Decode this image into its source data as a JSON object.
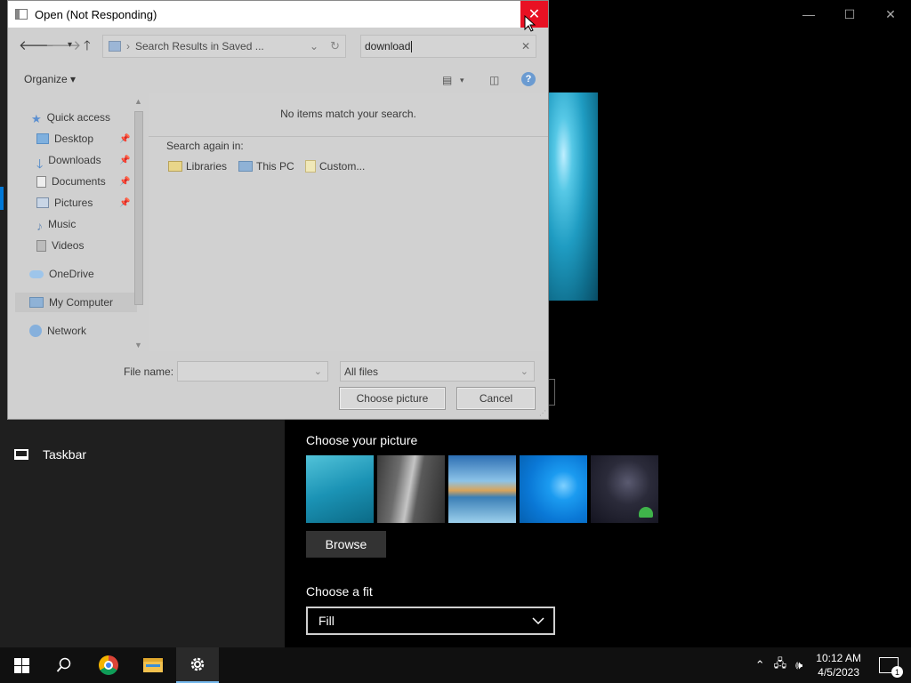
{
  "settings": {
    "nav_taskbar": "Taskbar",
    "choose_picture_label": "Choose your picture",
    "browse_label": "Browse",
    "choose_fit_label": "Choose a fit",
    "fit_value": "Fill",
    "window_controls": {
      "minimize": "—",
      "maximize": "☐",
      "close": "✕"
    }
  },
  "dialog": {
    "title": "Open (Not Responding)",
    "close_glyph": "✕",
    "address": "Search Results in Saved ...",
    "search_value": "download",
    "organize_label": "Organize ▾",
    "nav_items": [
      {
        "label": "Quick access",
        "icon": "star-icon"
      },
      {
        "label": "Desktop",
        "icon": "desktop-icon",
        "pinned": true
      },
      {
        "label": "Downloads",
        "icon": "download-icon",
        "pinned": true
      },
      {
        "label": "Documents",
        "icon": "document-icon",
        "pinned": true
      },
      {
        "label": "Pictures",
        "icon": "pictures-icon",
        "pinned": true
      },
      {
        "label": "Music",
        "icon": "music-icon"
      },
      {
        "label": "Videos",
        "icon": "videos-icon"
      },
      {
        "label": "OneDrive",
        "icon": "cloud-icon"
      },
      {
        "label": "My Computer",
        "icon": "computer-icon"
      },
      {
        "label": "Network",
        "icon": "network-icon"
      }
    ],
    "no_items_text": "No items match your search.",
    "search_again_label": "Search again in:",
    "search_locations": [
      "Libraries",
      "This PC",
      "Custom..."
    ],
    "file_name_label": "File name:",
    "file_name_value": "",
    "file_type_value": "All files",
    "choose_button": "Choose picture",
    "cancel_button": "Cancel"
  },
  "taskbar": {
    "apps": [
      "start-icon",
      "search-icon",
      "chrome-icon",
      "file-explorer-icon",
      "settings-icon"
    ],
    "time": "10:12 AM",
    "date": "4/5/2023",
    "notification_count": "1"
  }
}
